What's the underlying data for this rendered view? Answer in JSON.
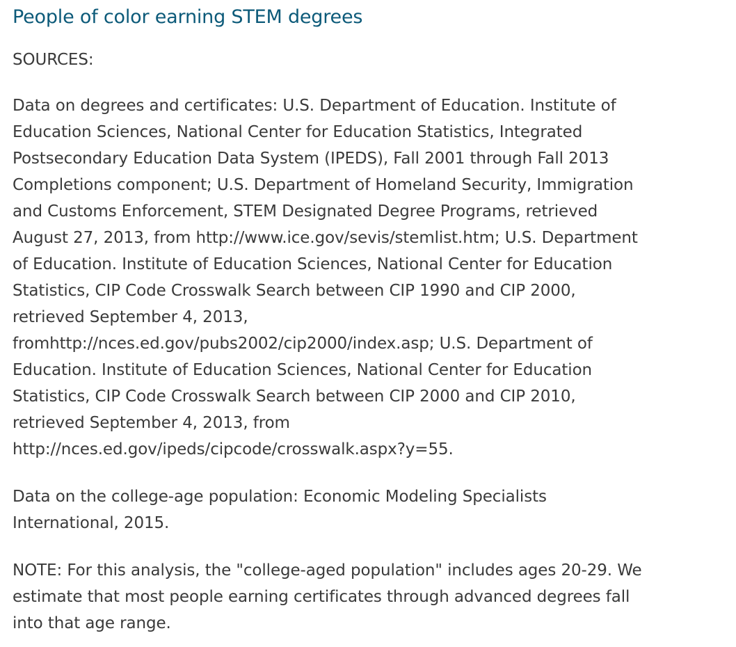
{
  "title": "People of color earning STEM degrees",
  "sources_label": "SOURCES:",
  "data_degrees_lines": [
    "Data on degrees and certificates: U.S. Department of Education. Institute of",
    "Education Sciences, National Center for Education Statistics, Integrated",
    "Postsecondary Education Data System (IPEDS), Fall 2001 through Fall 2013",
    "Completions component; U.S. Department of Homeland Security, Immigration",
    "and Customs Enforcement, STEM Designated Degree Programs, retrieved",
    "August 27, 2013, from http://www.ice.gov/sevis/stemlist.htm; U.S. Department",
    "of Education. Institute of Education Sciences, National Center for Education",
    "Statistics, CIP Code Crosswalk Search between CIP 1990 and CIP 2000,",
    "retrieved September 4, 2013,",
    "fromhttp://nces.ed.gov/pubs2002/cip2000/index.asp; U.S. Department of",
    "Education. Institute of Education Sciences, National Center for Education",
    "Statistics, CIP Code Crosswalk Search between CIP 2000 and CIP 2010,",
    "retrieved September 4, 2013, from",
    "http://nces.ed.gov/ipeds/cipcode/crosswalk.aspx?y=55."
  ],
  "data_population_lines": [
    "Data on the college-age population: Economic Modeling Specialists",
    "International, 2015."
  ],
  "note_lines": [
    "NOTE: For this analysis, the \"college-aged population\" includes ages 20-29. We",
    "estimate that most people earning certificates through advanced degrees fall",
    "into that age range."
  ]
}
